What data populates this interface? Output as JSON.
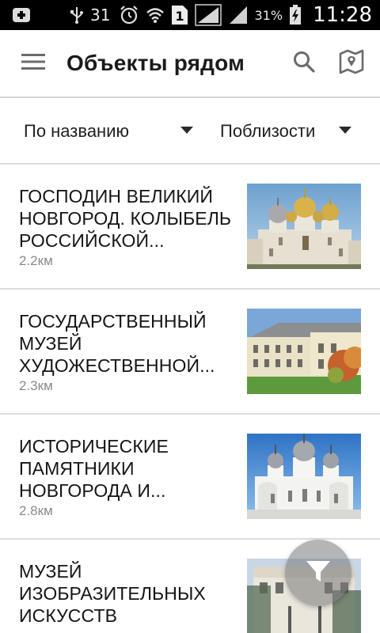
{
  "status_bar": {
    "notification_count": "31",
    "sim_slot": "1",
    "battery_percent": "31%",
    "time": "11:28"
  },
  "app_bar": {
    "title": "Объекты рядом",
    "menu_icon": "hamburger-menu-icon",
    "search_icon": "search-icon",
    "map_icon": "map-icon"
  },
  "filters": {
    "sort": "По названию",
    "area": "Поблизости"
  },
  "items": [
    {
      "title": "Господин Великий Новгород. Колыбель российской...",
      "distance": "2.2км",
      "image": "cathedral-golden-domes"
    },
    {
      "title": "Государственный музей художественной...",
      "distance": "2.3км",
      "image": "museum-building-lawn"
    },
    {
      "title": "Исторические памятники Новгорода и...",
      "distance": "2.8км",
      "image": "white-cathedral-grey-domes"
    },
    {
      "title": "Музей изобразительных искусств",
      "distance": "",
      "image": "classical-building-trees"
    }
  ],
  "fab": {
    "icon": "filter-funnel-icon"
  },
  "colors": {
    "status_bar_bg": "#000000",
    "app_bar_bg": "#ffffff",
    "divider": "#dedede",
    "distance_text": "#8a8a8a",
    "fab_bg": "#787878"
  }
}
